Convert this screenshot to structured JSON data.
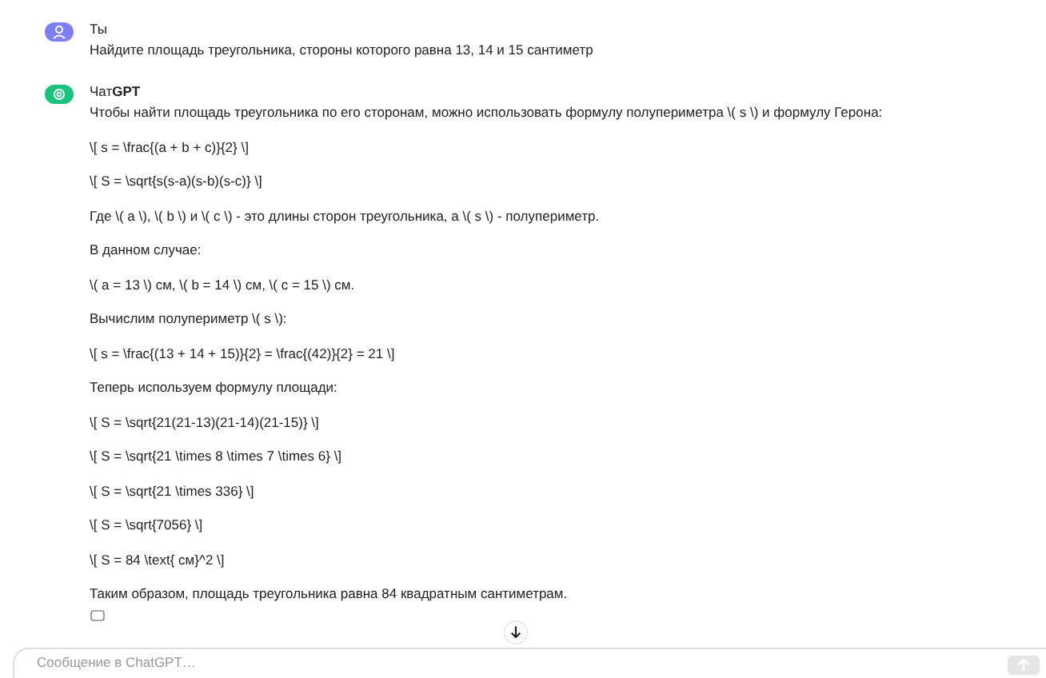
{
  "messages": [
    {
      "kind": "user",
      "author": "Ты",
      "paragraphs": [
        "Найдите площадь треугольника, стороны которого равна 13, 14 и 15 сантиметр"
      ]
    },
    {
      "kind": "assistant",
      "author": "Чат**GPT**",
      "paragraphs": [
        "Чтобы найти площадь треугольника по его сторонам, можно использовать формулу полупериметра \\( s \\) и формулу Герона:",
        "\\[ s = \\frac{(a + b + c)}{2} \\]",
        "\\[ S = \\sqrt{s(s-a)(s-b)(s-c)} \\]",
        "Где \\( a \\), \\( b \\) и \\( c \\) - это длины сторон треугольника, а \\( s \\) - полупериметр.",
        "В данном случае:",
        "\\( a = 13 \\) см, \\( b = 14 \\) см, \\( c = 15 \\) см.",
        "Вычислим полупериметр \\( s \\):",
        "\\[ s = \\frac{(13 + 14 + 15)}{2} = \\frac{(42)}{2} = 21 \\]",
        "Теперь используем формулу площади:",
        "\\[ S = \\sqrt{21(21-13)(21-14)(21-15)} \\]",
        "\\[ S = \\sqrt{21 \\times 8 \\times 7 \\times 6} \\]",
        "\\[ S = \\sqrt{21 \\times 336} \\]",
        "\\[ S = \\sqrt{7056} \\]",
        "\\[ S = 84 \\text{ см}^2 \\]",
        "Таким образом, площадь треугольника равна 84 квадратным сантиметрам."
      ]
    }
  ],
  "composer": {
    "placeholder": "Сообщение в ChatGPT…"
  }
}
